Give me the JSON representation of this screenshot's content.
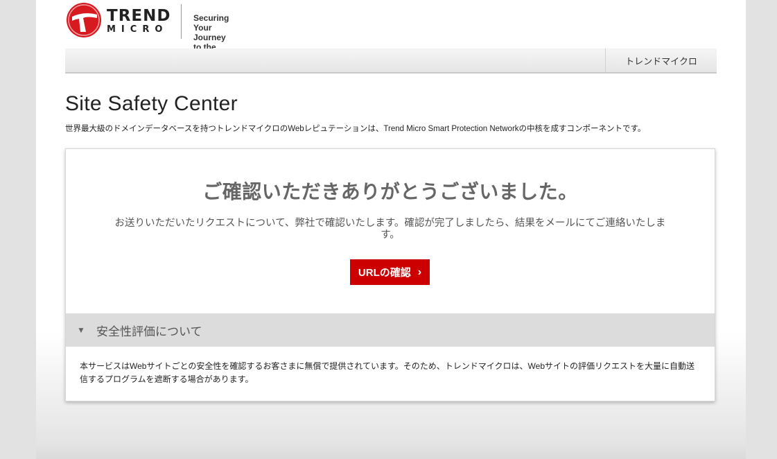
{
  "header": {
    "logo_line1": "TREND",
    "logo_line2": "MICRO",
    "tagline_line1": "Securing Your Journey",
    "tagline_line2": "to the Cloud",
    "brand_color": "#d71920"
  },
  "nav": {
    "link_label": "トレンドマイクロ"
  },
  "main": {
    "title": "Site Safety Center",
    "description": "世界最大級のドメインデータベースを持つトレンドマイクロのWebレピュテーションは、Trend Micro Smart Protection Networkの中核を成すコンポーネントです。"
  },
  "card": {
    "heading": "ご確認いただきありがとうございました。",
    "message": "お送りいただいたリクエストについて、弊社で確認いたします。確認が完了しましたら、結果をメールにてご連絡いたします。",
    "button_label": "URLの確認",
    "button_icon": "chevron-right-icon",
    "button_color": "#cc0000"
  },
  "accordion": {
    "arrow_icon": "triangle-down-icon",
    "title": "安全性評価について",
    "body": "本サービスはWebサイトごとの安全性を確認するお客さまに無償で提供されています。そのため、トレンドマイクロは、Webサイトの評価リクエストを大量に自動送信するプログラムを遮断する場合があります。"
  }
}
